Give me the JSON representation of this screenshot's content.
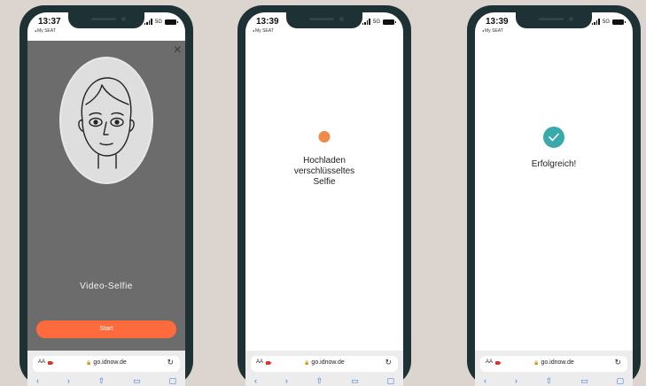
{
  "screens": [
    {
      "time": "13:37",
      "carrier": "My SEAT",
      "network": "5G",
      "close_icon": "×",
      "title": "Video-Selfie",
      "start_label": "Start",
      "aa": "AA",
      "url": "go.idnow.de",
      "lock_icon": "🔒",
      "reload_icon": "↻"
    },
    {
      "time": "13:39",
      "carrier": "My SEAT",
      "network": "5G",
      "status_lines": [
        "Hochladen",
        "verschlüsseltes",
        "Selfie"
      ],
      "aa": "AA",
      "url": "go.idnow.de",
      "lock_icon": "🔒",
      "reload_icon": "↻"
    },
    {
      "time": "13:39",
      "carrier": "My SEAT",
      "network": "5G",
      "success": "Erfolgreich!",
      "aa": "AA",
      "url": "go.idnow.de",
      "lock_icon": "🔒",
      "reload_icon": "↻"
    }
  ],
  "colors": {
    "background": "#dcd5cf",
    "phone_frame": "#1e3236",
    "accent_orange": "#ff6b3c",
    "loader_orange": "#f08a4b",
    "success_teal": "#39a9ab",
    "selfie_bg": "#6c6c6c"
  },
  "icons": {
    "close": "close-icon",
    "face": "face-illustration",
    "loader": "loading-dot-icon",
    "success": "check-circle-icon",
    "record": "video-record-icon",
    "reload": "reload-icon"
  }
}
